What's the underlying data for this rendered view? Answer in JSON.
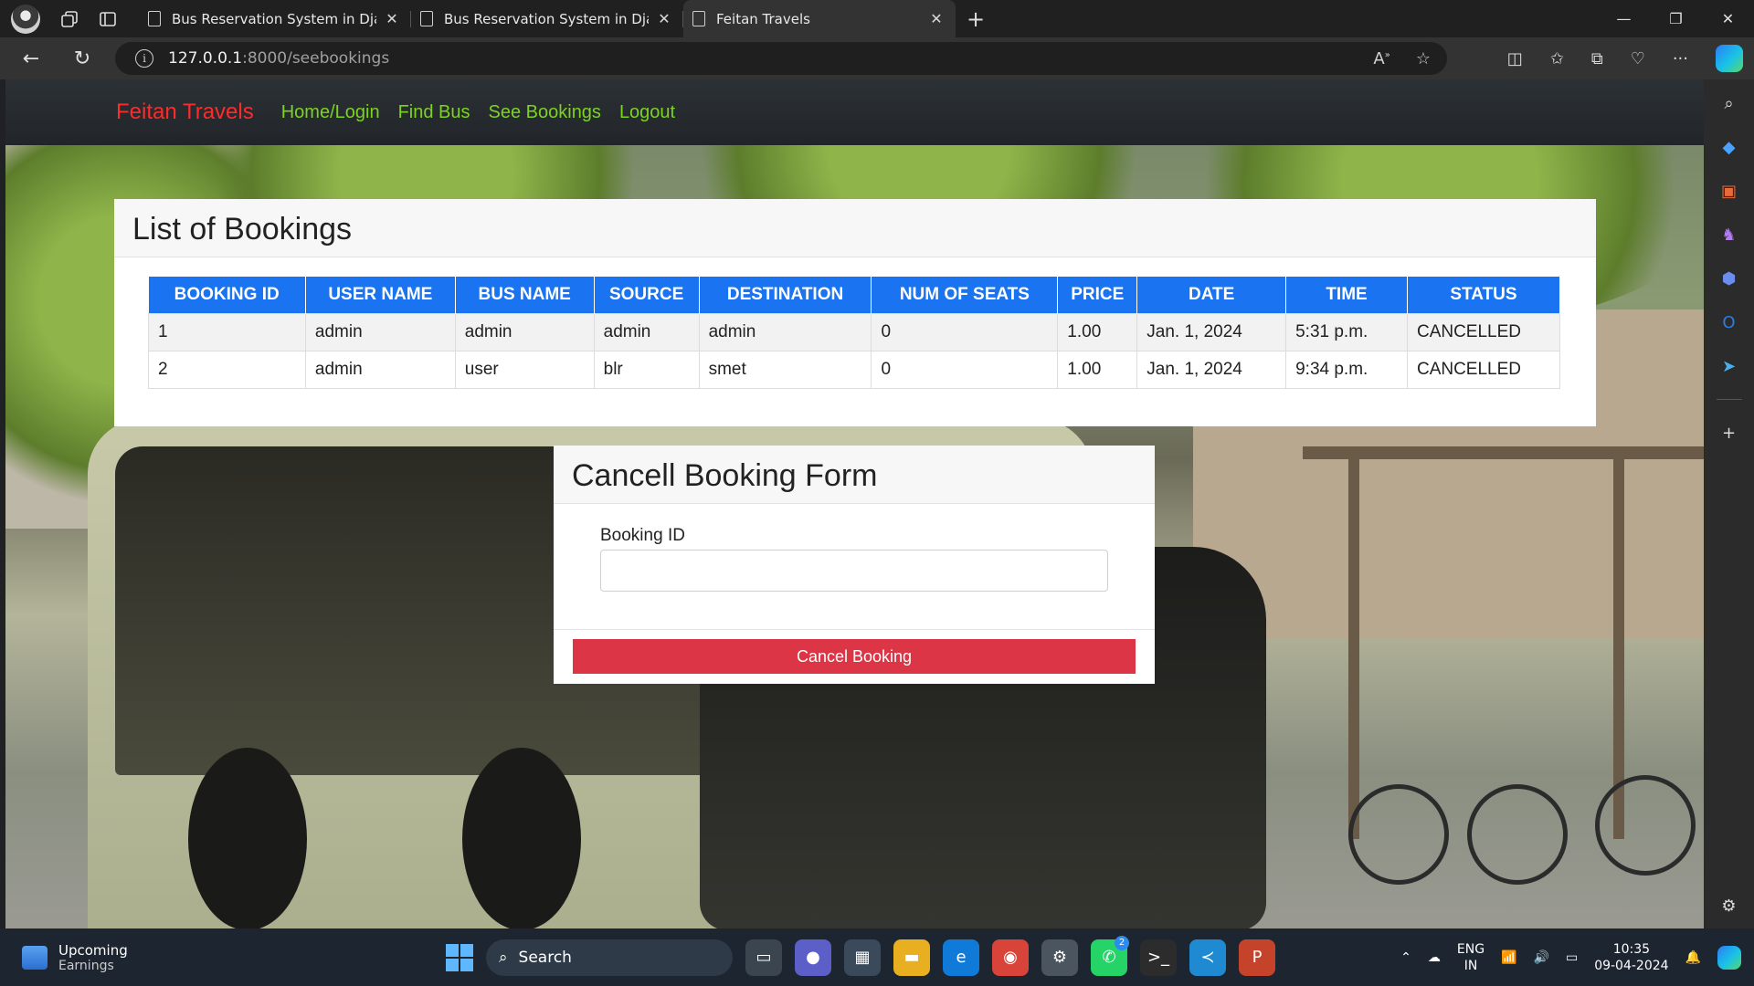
{
  "browser": {
    "tabs": [
      {
        "title": "Bus Reservation System in Djang",
        "active": false
      },
      {
        "title": "Bus Reservation System in Djang",
        "active": false
      },
      {
        "title": "Feitan Travels",
        "active": true
      }
    ],
    "url_host": "127.0.0.1",
    "url_path": ":8000/seebookings"
  },
  "navbar": {
    "brand": "Feitan Travels",
    "links": [
      "Home/Login",
      "Find Bus",
      "See Bookings",
      "Logout"
    ],
    "brand_color": "#ff2a2a",
    "link_color": "#7cd320"
  },
  "bookings": {
    "heading": "List of Bookings",
    "columns": [
      "BOOKING ID",
      "USER NAME",
      "BUS NAME",
      "SOURCE",
      "DESTINATION",
      "NUM OF SEATS",
      "PRICE",
      "DATE",
      "TIME",
      "STATUS"
    ],
    "rows": [
      [
        "1",
        "admin",
        "admin",
        "admin",
        "admin",
        "0",
        "1.00",
        "Jan. 1, 2024",
        "5:31 p.m.",
        "CANCELLED"
      ],
      [
        "2",
        "admin",
        "user",
        "blr",
        "smet",
        "0",
        "1.00",
        "Jan. 1, 2024",
        "9:34 p.m.",
        "CANCELLED"
      ]
    ],
    "header_color": "#1a73f0"
  },
  "cancel_form": {
    "heading": "Cancell Booking Form",
    "label": "Booking ID",
    "value": "",
    "button": "Cancel Booking",
    "button_color": "#dc3545"
  },
  "taskbar": {
    "weather_title": "Upcoming",
    "weather_sub": "Earnings",
    "search": "Search",
    "lang1": "ENG",
    "lang2": "IN",
    "time": "10:35",
    "date": "09-04-2024",
    "whatsapp_badge": "2"
  }
}
